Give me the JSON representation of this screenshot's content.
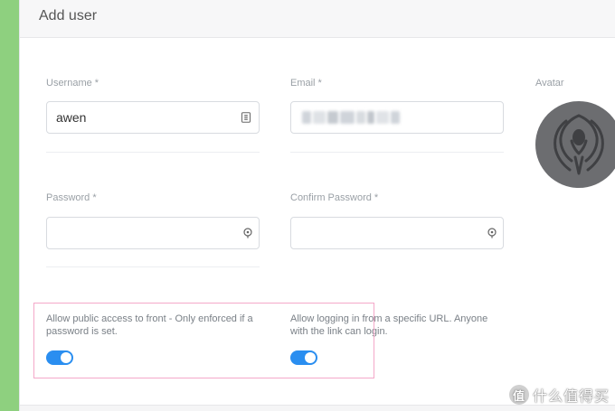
{
  "header": {
    "title": "Add user"
  },
  "form": {
    "username": {
      "label": "Username *",
      "value": "awen"
    },
    "email": {
      "label": "Email *"
    },
    "avatar": {
      "label": "Avatar"
    },
    "password": {
      "label": "Password *",
      "value": ""
    },
    "confirm_password": {
      "label": "Confirm Password *",
      "value": ""
    }
  },
  "toggles": {
    "public_access": {
      "label": "Allow public access to front - Only enforced if a password is set.",
      "enabled": true
    },
    "url_login": {
      "label": "Allow logging in from a specific URL. Anyone with the link can login.",
      "enabled": true
    }
  },
  "colors": {
    "sidebar_green": "#8ed07f",
    "toggle_blue": "#2a8ef0",
    "highlight_pink": "#f4a8c9",
    "avatar_gray": "#6c6d70"
  },
  "watermark": {
    "badge": "值",
    "text": "什么值得买"
  }
}
